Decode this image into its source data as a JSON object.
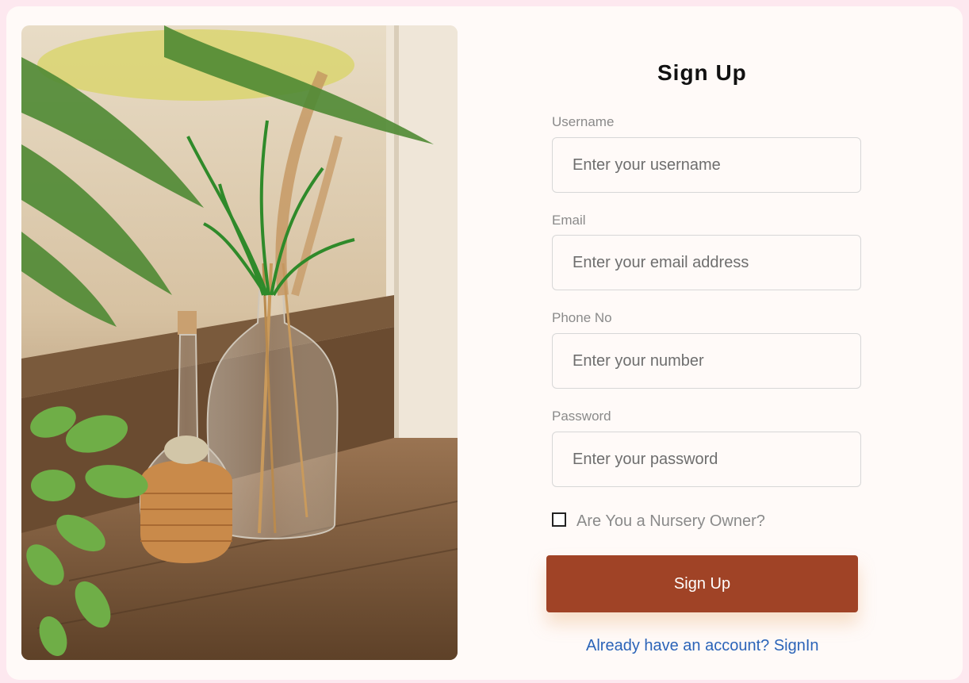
{
  "form": {
    "title": "Sign Up",
    "fields": [
      {
        "label": "Username",
        "placeholder": "Enter your username",
        "value": ""
      },
      {
        "label": "Email",
        "placeholder": "Enter your email address",
        "value": ""
      },
      {
        "label": "Phone No",
        "placeholder": "Enter your number",
        "value": ""
      },
      {
        "label": "Password",
        "placeholder": "Enter your password",
        "value": ""
      }
    ],
    "checkbox": {
      "label": "Are You a Nursery Owner?",
      "checked": false
    },
    "submit_label": "Sign Up",
    "signin_link": "Already have an account? SignIn"
  },
  "colors": {
    "page_background": "#fde8ef",
    "card_background": "#fffaf8",
    "button": "#a04326",
    "link": "#2b64b8",
    "label": "#8a8a8a"
  }
}
